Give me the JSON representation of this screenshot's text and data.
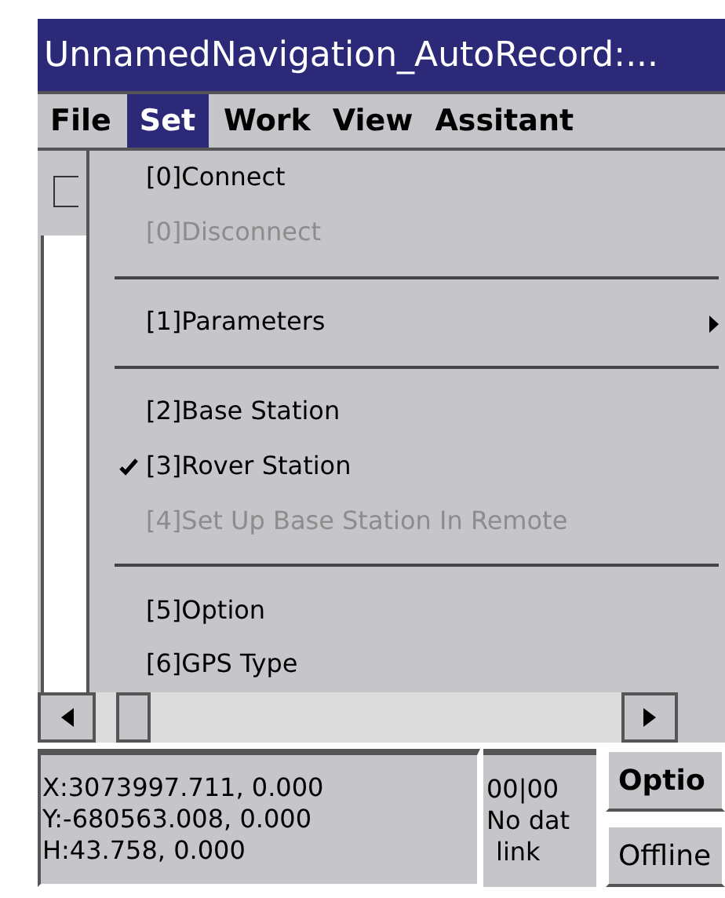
{
  "window": {
    "title": "UnnamedNavigation_AutoRecord:..."
  },
  "menu_bar": [
    {
      "label": "File",
      "selected": false
    },
    {
      "label": "Set",
      "selected": true
    },
    {
      "label": "Work",
      "selected": false
    },
    {
      "label": "View",
      "selected": false
    },
    {
      "label": "Assitant",
      "selected": false
    }
  ],
  "dropdown": [
    {
      "kind": "item",
      "label": "[0]Connect",
      "disabled": false,
      "checked": false,
      "submenu": false
    },
    {
      "kind": "item",
      "label": "[0]Disconnect",
      "disabled": true,
      "checked": false,
      "submenu": false
    },
    {
      "kind": "separator"
    },
    {
      "kind": "item",
      "label": "[1]Parameters",
      "disabled": false,
      "checked": false,
      "submenu": true
    },
    {
      "kind": "separator"
    },
    {
      "kind": "item",
      "label": "[2]Base Station",
      "disabled": false,
      "checked": false,
      "submenu": false
    },
    {
      "kind": "item",
      "label": "[3]Rover Station",
      "disabled": false,
      "checked": true,
      "submenu": false
    },
    {
      "kind": "item",
      "label": "[4]Set Up Base Station In Remote",
      "disabled": true,
      "checked": false,
      "submenu": false
    },
    {
      "kind": "separator"
    },
    {
      "kind": "item",
      "label": "[5]Option",
      "disabled": false,
      "checked": false,
      "submenu": false
    },
    {
      "kind": "item",
      "label": "[6]GPS Type",
      "disabled": false,
      "checked": false,
      "submenu": false
    }
  ],
  "status": {
    "coordinates": [
      "X:3073997.711, 0.000",
      "Y:-680563.008, 0.000",
      "H:43.758, 0.000"
    ],
    "link_info": [
      "00|00",
      "No dat",
      "link"
    ],
    "buttons": [
      "Optio",
      "Offline"
    ]
  }
}
